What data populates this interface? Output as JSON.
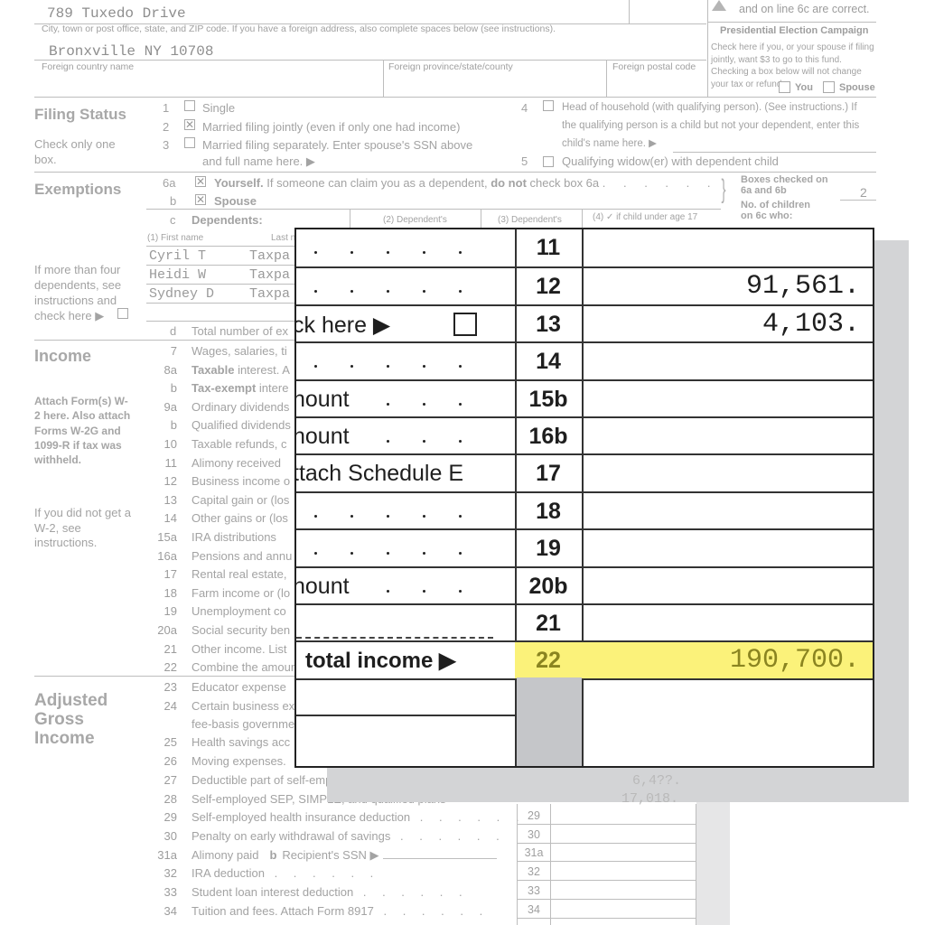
{
  "address": {
    "street": "789 Tuxedo Drive",
    "city_label": "City, town or post office, state, and ZIP code. If you have a foreign address, also complete spaces below (see instructions).",
    "city_value": "Bronxville NY 10708",
    "foreign_country_label": "Foreign country name",
    "foreign_province_label": "Foreign province/state/county",
    "foreign_postal_label": "Foreign postal code",
    "ssn_note": "and on line 6c are correct."
  },
  "campaign": {
    "title": "Presidential Election Campaign",
    "text": "Check here if you, or your spouse if filing jointly, want $3 to go to this fund. Checking a box below will not change your tax or refund.",
    "you_label": "You",
    "spouse_label": "Spouse"
  },
  "filing_status": {
    "title": "Filing Status",
    "note": "Check only one box.",
    "options": [
      {
        "num": "1",
        "label": "Single",
        "checked": false
      },
      {
        "num": "2",
        "label": "Married filing jointly (even if only one had income)",
        "checked": true
      },
      {
        "num": "3",
        "label": "Married filing separately. Enter spouse's SSN above",
        "label2": "and full name here. ▶",
        "checked": false
      },
      {
        "num": "4",
        "label": "Head of household (with qualifying person). (See instructions.) If",
        "label2": "the qualifying person is a child but not your dependent, enter this",
        "label3": "child's name here. ▶",
        "checked": false
      },
      {
        "num": "5",
        "label": "Qualifying widow(er) with dependent child",
        "checked": false
      }
    ]
  },
  "exemptions": {
    "title": "Exemptions",
    "line_6a_num": "6a",
    "line_6a_bold": "Yourself.",
    "line_6a_text": "If someone can claim you as a dependent,",
    "line_6a_bold2": "do not",
    "line_6a_text2": "check box 6a",
    "line_6b_num": "b",
    "line_6b_label": "Spouse",
    "line_6c_num": "c",
    "line_6c_label": "Dependents:",
    "col1": "(1) First name",
    "col1_last": "Last name",
    "col2": "(2) Dependent's",
    "col3": "(3) Dependent's",
    "col4": "(4) ✓ if child under age 17",
    "boxes_checked_label": "Boxes checked on 6a and 6b",
    "boxes_checked_value": "2",
    "children_label": "No. of children on 6c who:",
    "more_than_four": "If more than four dependents, see instructions and check here ▶",
    "dependents": [
      {
        "first": "Cyril T",
        "last": "Taxpa"
      },
      {
        "first": "Heidi W",
        "last": "Taxpa"
      },
      {
        "first": "Sydney D",
        "last": "Taxpa"
      }
    ],
    "line_d_num": "d",
    "line_d_label": "Total number of ex"
  },
  "income": {
    "title": "Income",
    "attach_note": "Attach Form(s) W-2 here. Also attach Forms W-2G and 1099-R if tax was withheld.",
    "w2_note": "If you did not get a W-2, see instructions.",
    "lines": [
      {
        "num": "7",
        "label": "Wages, salaries, ti"
      },
      {
        "num": "8a",
        "label_bold": "Taxable",
        "label": " interest. A"
      },
      {
        "num": "b",
        "label_bold": "Tax-exempt",
        "label": " intere"
      },
      {
        "num": "9a",
        "label": "Ordinary dividends"
      },
      {
        "num": "b",
        "label": "Qualified dividends"
      },
      {
        "num": "10",
        "label": "Taxable refunds, c"
      },
      {
        "num": "11",
        "label": "Alimony received"
      },
      {
        "num": "12",
        "label": "Business income o"
      },
      {
        "num": "13",
        "label": "Capital gain or (los"
      },
      {
        "num": "14",
        "label": "Other gains or (los"
      },
      {
        "num": "15a",
        "label": "IRA distributions"
      },
      {
        "num": "16a",
        "label": "Pensions and annu"
      },
      {
        "num": "17",
        "label": "Rental real estate,"
      },
      {
        "num": "18",
        "label": "Farm income or (lo"
      },
      {
        "num": "19",
        "label": "Unemployment co"
      },
      {
        "num": "20a",
        "label": "Social security ben"
      },
      {
        "num": "21",
        "label": "Other income. List"
      },
      {
        "num": "22",
        "label": "Combine the amoun"
      }
    ]
  },
  "agi": {
    "title": "Adjusted Gross Income",
    "lines": [
      {
        "num": "23",
        "label": "Educator expense"
      },
      {
        "num": "24",
        "label": "Certain business exp",
        "label2": "fee-basis governmen"
      },
      {
        "num": "25",
        "label": "Health savings acc"
      },
      {
        "num": "26",
        "label": "Moving expenses."
      },
      {
        "num": "27",
        "label": "Deductible part of self-emp"
      },
      {
        "num": "28",
        "label": "Self-employed SEP, SIMPLE, and qualified plans"
      },
      {
        "num": "29",
        "label": "Self-employed health insurance deduction",
        "box": "29"
      },
      {
        "num": "30",
        "label": "Penalty on early withdrawal of savings",
        "box": "30"
      },
      {
        "num": "31a",
        "label": "Alimony paid",
        "label_b": "b",
        "label_b_text": "Recipient's SSN ▶",
        "box": "31a"
      },
      {
        "num": "32",
        "label": "IRA deduction",
        "box": "32"
      },
      {
        "num": "33",
        "label": "Student loan interest deduction",
        "box": "33"
      },
      {
        "num": "34",
        "label": "Tuition and fees. Attach Form 8917",
        "box": "34"
      }
    ],
    "faded_values": {
      "line27": "6,4??.",
      "line28": "17,018."
    }
  },
  "zoom_overlay": {
    "rows": [
      {
        "label": "",
        "dots": true,
        "line": "11",
        "value": ""
      },
      {
        "label": "",
        "dots": true,
        "line": "12",
        "value": "91,561."
      },
      {
        "label": "ck here ▶",
        "checkbox": true,
        "line": "13",
        "value": "4,103."
      },
      {
        "label": "",
        "dots": true,
        "line": "14",
        "value": ""
      },
      {
        "label": "nount",
        "dots": true,
        "line": "15b",
        "value": ""
      },
      {
        "label": "nount",
        "dots": true,
        "line": "16b",
        "value": ""
      },
      {
        "label": "ttach Schedule E",
        "line": "17",
        "value": ""
      },
      {
        "label": "",
        "dots": true,
        "line": "18",
        "value": ""
      },
      {
        "label": "",
        "dots": true,
        "line": "19",
        "value": ""
      },
      {
        "label": "nount",
        "dots": true,
        "line": "20b",
        "value": ""
      },
      {
        "label": "",
        "line": "21",
        "value": ""
      },
      {
        "label": "total income ▶",
        "line": "22",
        "value": "190,700.",
        "highlight": true
      }
    ],
    "highlight_color": "#fbf27a",
    "highlight_text_color": "#8a8420"
  }
}
